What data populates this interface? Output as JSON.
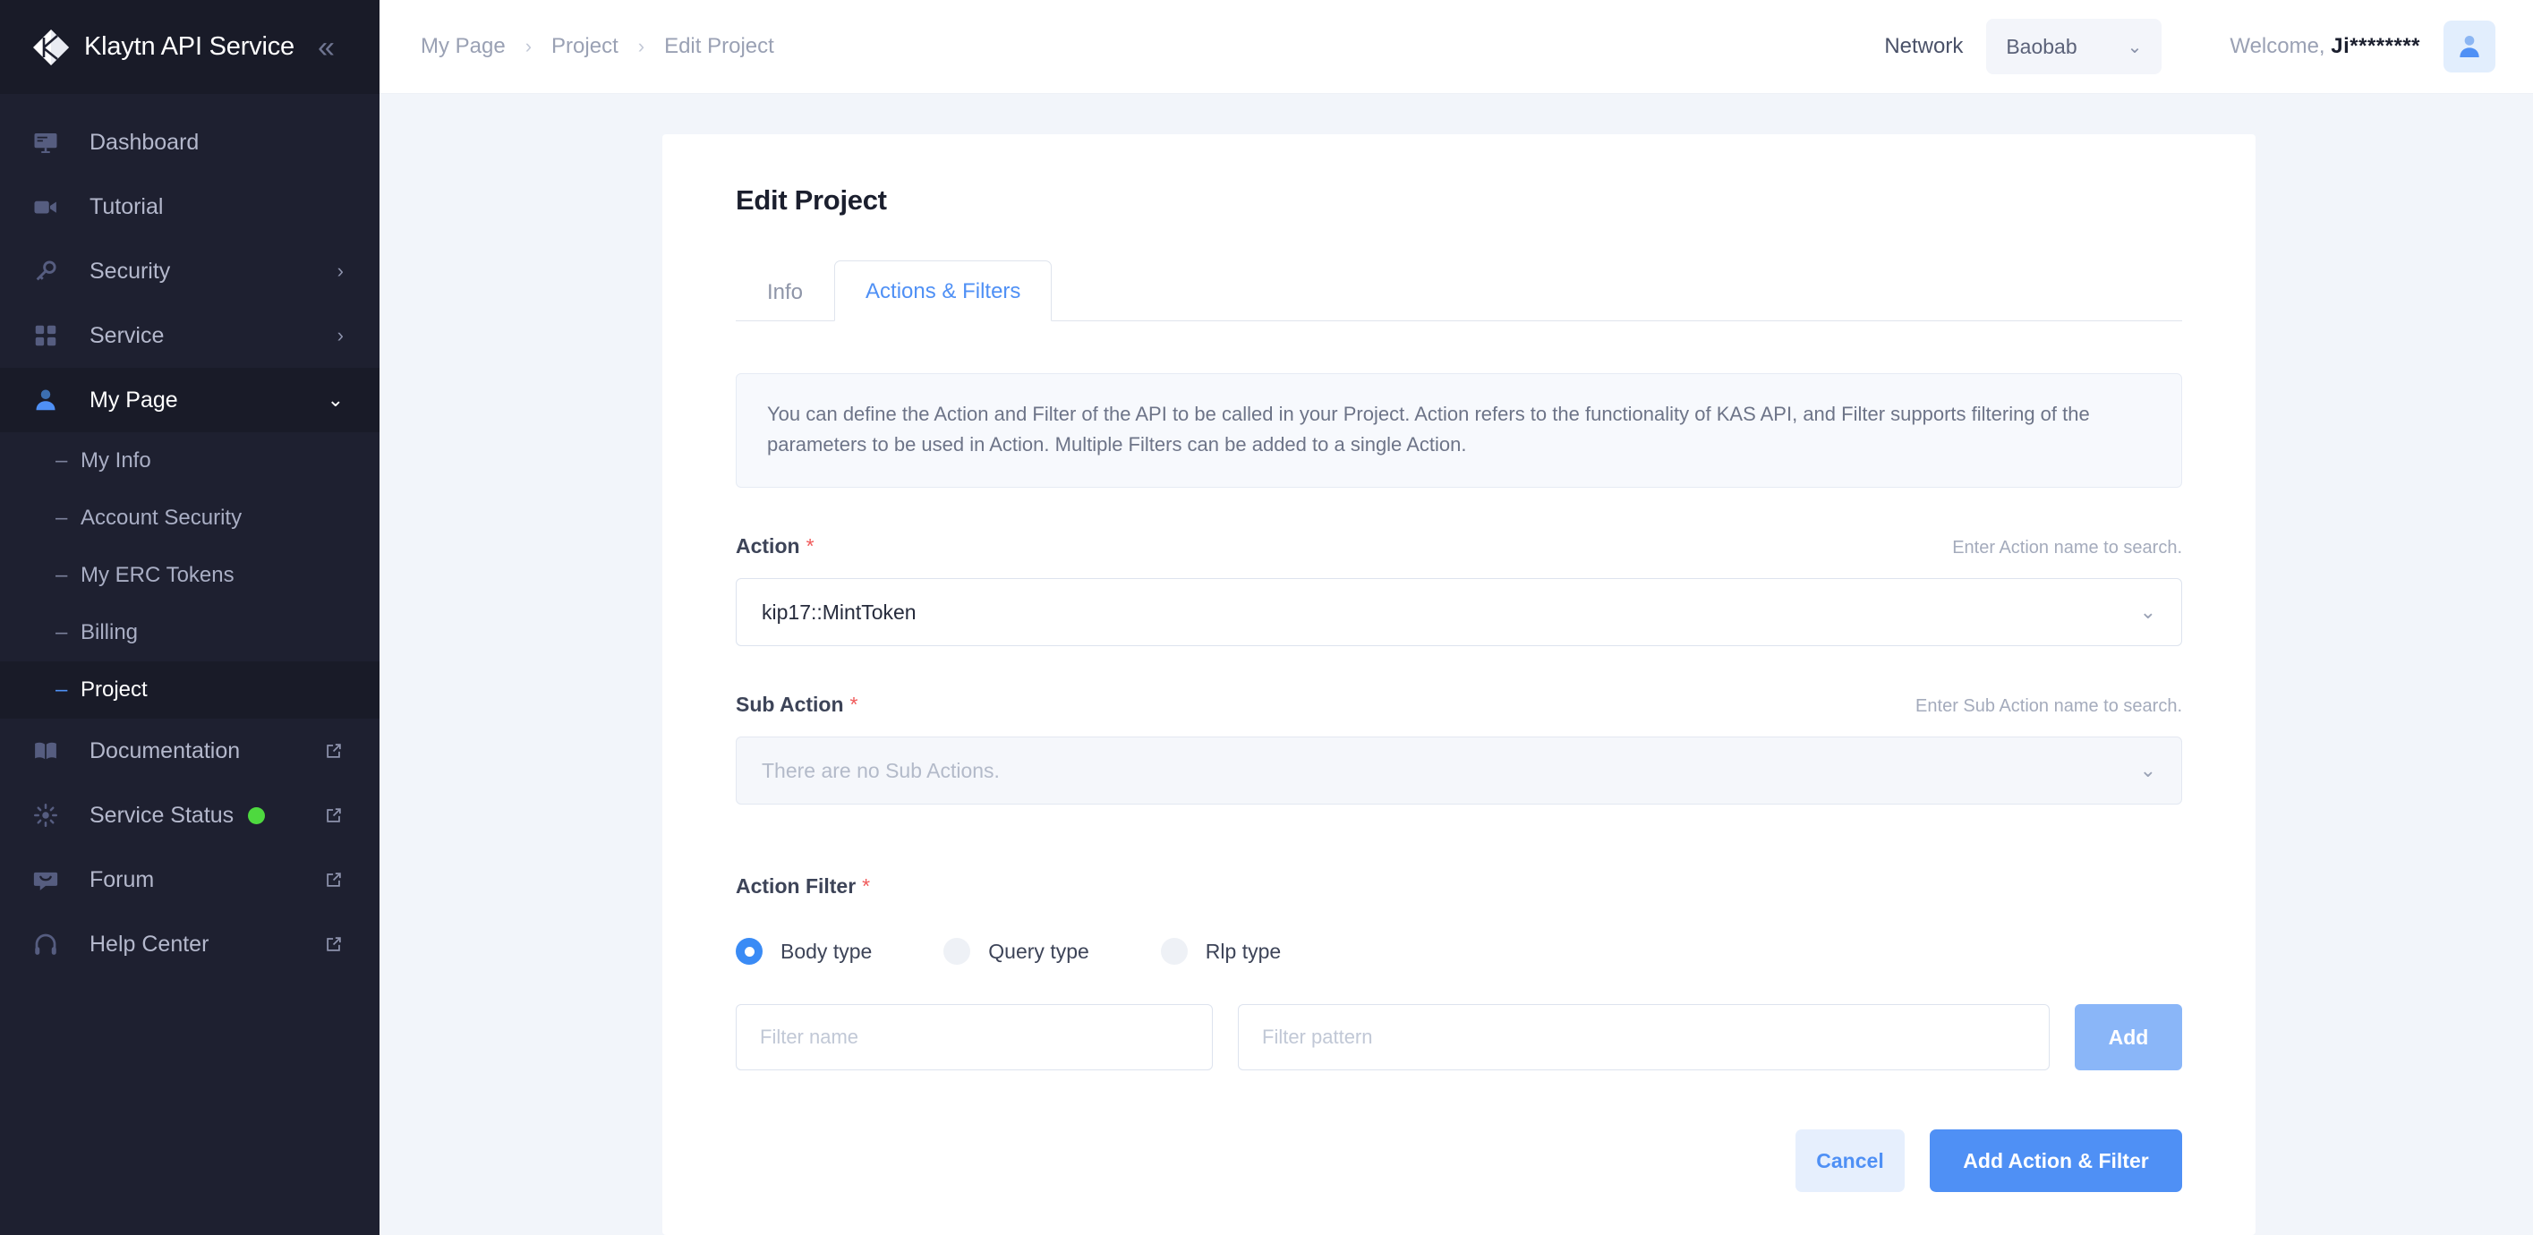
{
  "brand": {
    "title": "Klaytn API Service",
    "collapse_glyph": "«"
  },
  "sidebar": {
    "items": [
      {
        "label": "Dashboard",
        "icon": "monitor-icon",
        "type": "link"
      },
      {
        "label": "Tutorial",
        "icon": "video-camera-icon",
        "type": "link"
      },
      {
        "label": "Security",
        "icon": "key-icon",
        "type": "expandable",
        "chevron": "›"
      },
      {
        "label": "Service",
        "icon": "grid-icon",
        "type": "expandable",
        "chevron": "›"
      },
      {
        "label": "My Page",
        "icon": "user-icon",
        "type": "expandable",
        "chevron": "⌄",
        "active": true
      }
    ],
    "sub_items": [
      {
        "label": "My Info",
        "active": false
      },
      {
        "label": "Account Security",
        "active": false
      },
      {
        "label": "My ERC Tokens",
        "active": false
      },
      {
        "label": "Billing",
        "active": false
      },
      {
        "label": "Project",
        "active": true
      }
    ],
    "external_items": [
      {
        "label": "Documentation",
        "icon": "book-icon",
        "external": true
      },
      {
        "label": "Service Status",
        "icon": "sun-icon",
        "external": true,
        "status_color": "#4ed93f"
      },
      {
        "label": "Forum",
        "icon": "chat-icon",
        "external": true
      },
      {
        "label": "Help Center",
        "icon": "headset-icon",
        "external": true
      }
    ]
  },
  "topbar": {
    "breadcrumbs": [
      "My Page",
      "Project",
      "Edit Project"
    ],
    "breadcrumb_sep": "›",
    "network_label": "Network",
    "network_value": "Baobab",
    "network_chevron": "⌄",
    "welcome_prefix": "Welcome, ",
    "welcome_name": "Ji********"
  },
  "main": {
    "page_title": "Edit Project",
    "tabs": [
      {
        "label": "Info",
        "active": false
      },
      {
        "label": "Actions & Filters",
        "active": true
      }
    ],
    "info_text": "You can define the Action and Filter of the API to be called in your Project. Action refers to the functionality of KAS API, and Filter supports filtering of the parameters to be used in Action. Multiple Filters can be added to a single Action.",
    "action": {
      "label": "Action",
      "required_mark": "*",
      "hint": "Enter Action name to search.",
      "value": "kip17::MintToken",
      "chevron": "⌄"
    },
    "sub_action": {
      "label": "Sub Action",
      "required_mark": "*",
      "hint": "Enter Sub Action name to search.",
      "value": "There are no Sub Actions.",
      "chevron": "⌄",
      "disabled": true
    },
    "action_filter": {
      "label": "Action Filter",
      "required_mark": "*",
      "radios": [
        {
          "label": "Body type",
          "checked": true
        },
        {
          "label": "Query type",
          "checked": false
        },
        {
          "label": "Rlp type",
          "checked": false
        }
      ],
      "filter_name_placeholder": "Filter name",
      "filter_name_value": "",
      "filter_pattern_placeholder": "Filter pattern",
      "filter_pattern_value": "",
      "add_label": "Add"
    },
    "cancel_label": "Cancel",
    "submit_label": "Add Action & Filter"
  },
  "colors": {
    "accent": "#4f90f5",
    "sidebar_bg": "#1e2030",
    "page_bg": "#f2f5fa",
    "required": "#f05a5a",
    "status_green": "#4ed93f"
  }
}
